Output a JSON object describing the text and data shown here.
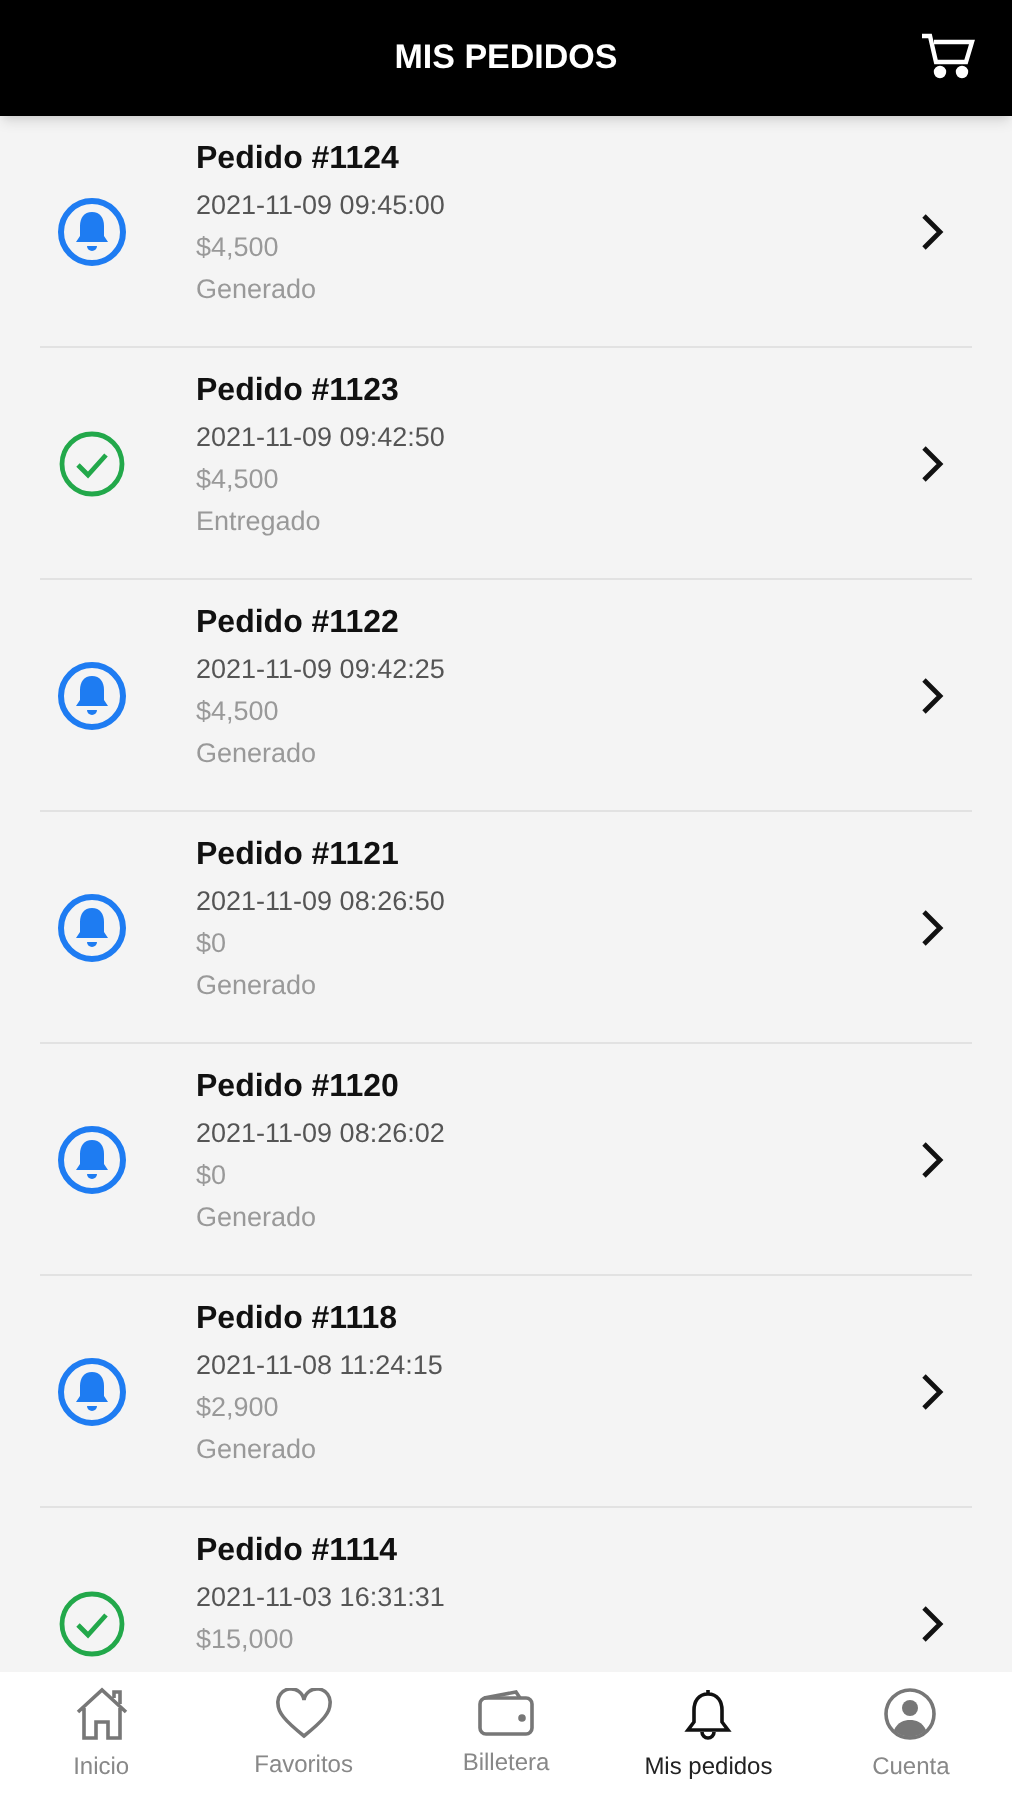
{
  "header": {
    "title": "MIS PEDIDOS"
  },
  "orders": [
    {
      "title": "Pedido #1124",
      "date": "2021-11-09 09:45:00",
      "amount": "$4,500",
      "status": "Generado",
      "kind": "generated"
    },
    {
      "title": "Pedido #1123",
      "date": "2021-11-09 09:42:50",
      "amount": "$4,500",
      "status": "Entregado",
      "kind": "delivered"
    },
    {
      "title": "Pedido #1122",
      "date": "2021-11-09 09:42:25",
      "amount": "$4,500",
      "status": "Generado",
      "kind": "generated"
    },
    {
      "title": "Pedido #1121",
      "date": "2021-11-09 08:26:50",
      "amount": "$0",
      "status": "Generado",
      "kind": "generated"
    },
    {
      "title": "Pedido #1120",
      "date": "2021-11-09 08:26:02",
      "amount": "$0",
      "status": "Generado",
      "kind": "generated"
    },
    {
      "title": "Pedido #1118",
      "date": "2021-11-08 11:24:15",
      "amount": "$2,900",
      "status": "Generado",
      "kind": "generated"
    },
    {
      "title": "Pedido #1114",
      "date": "2021-11-03 16:31:31",
      "amount": "$15,000",
      "kind": "delivered"
    }
  ],
  "nav": [
    {
      "label": "Inicio",
      "kind": "home",
      "selected": false
    },
    {
      "label": "Favoritos",
      "kind": "heart",
      "selected": false
    },
    {
      "label": "Billetera",
      "kind": "wallet",
      "selected": false
    },
    {
      "label": "Mis pedidos",
      "kind": "bell",
      "selected": true
    },
    {
      "label": "Cuenta",
      "kind": "account",
      "selected": false
    }
  ]
}
